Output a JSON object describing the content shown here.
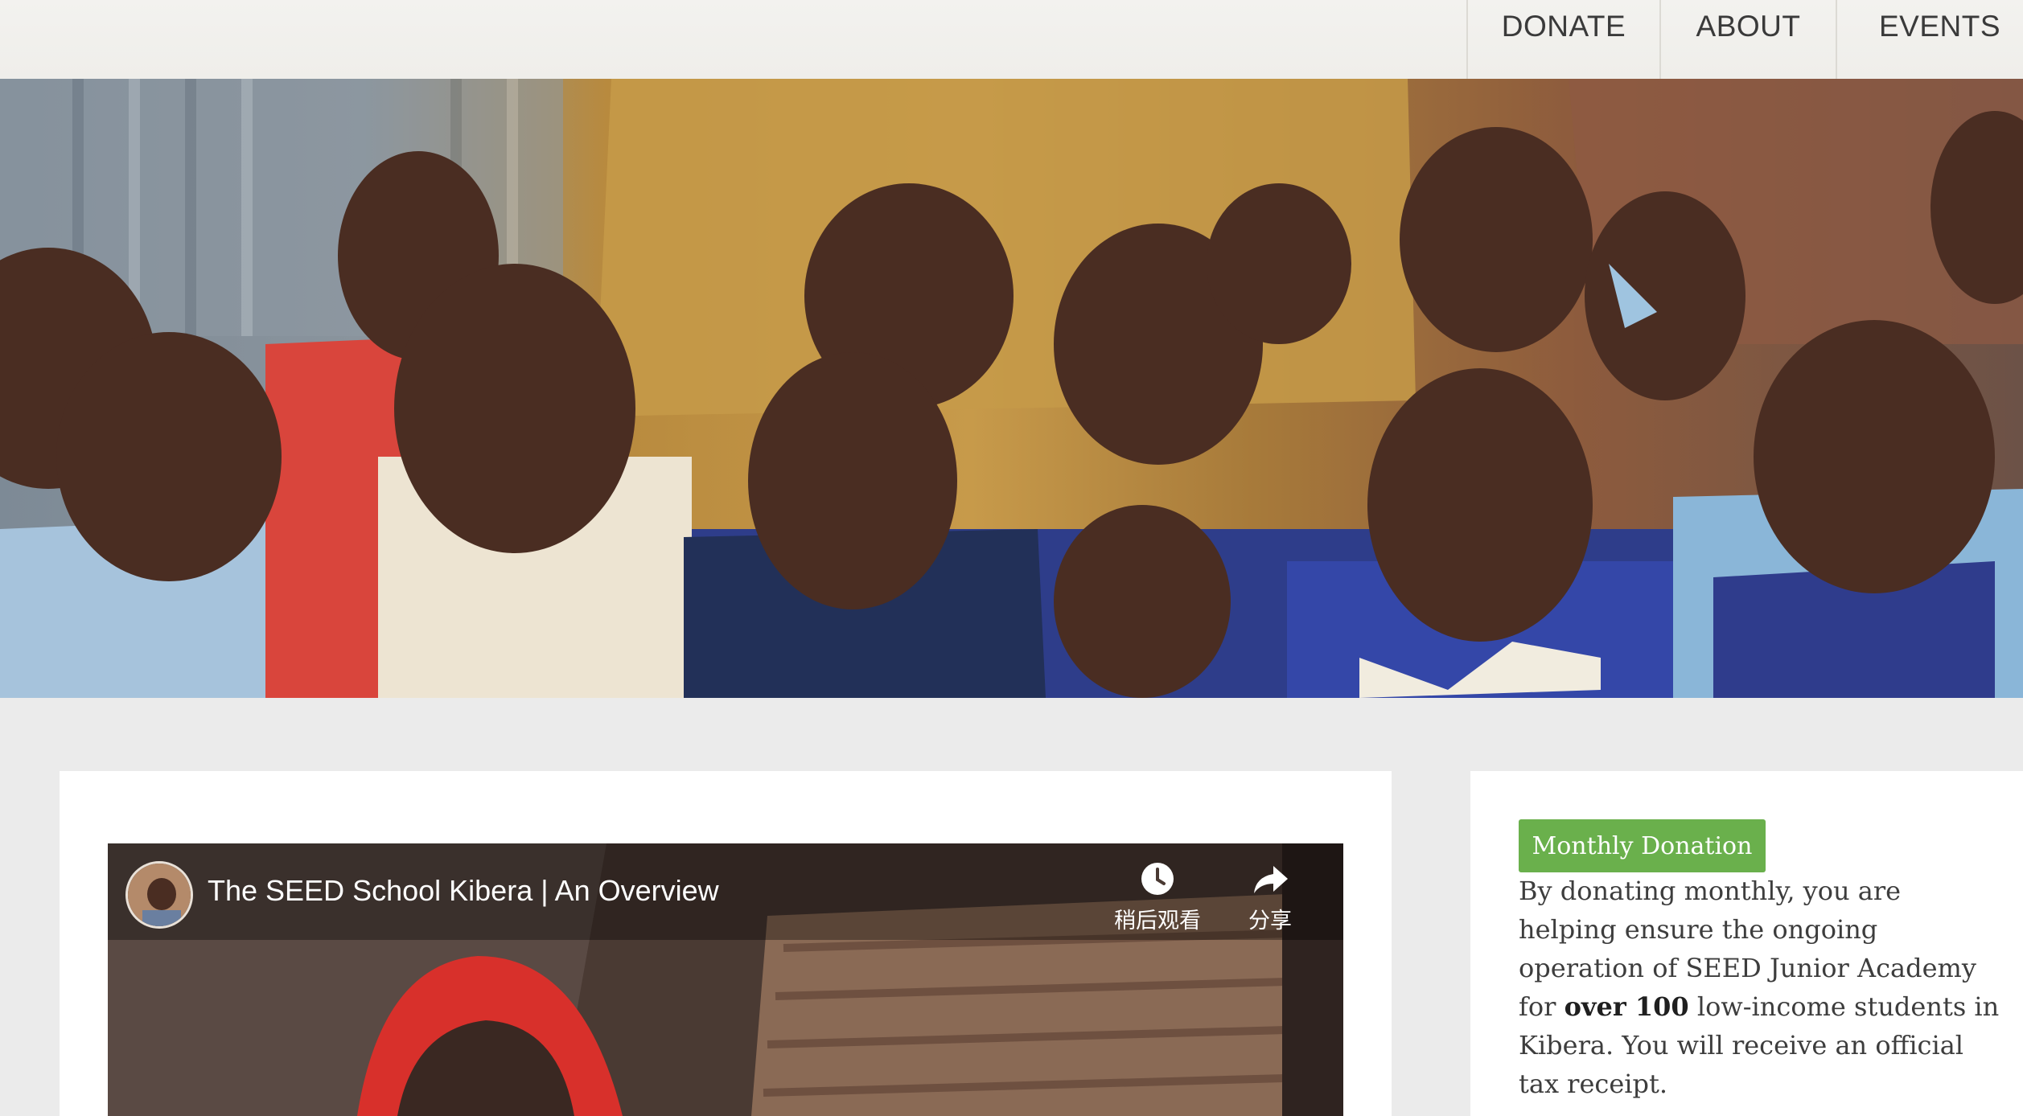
{
  "nav": {
    "donate": "DONATE",
    "about": "ABOUT",
    "events": "EVENTS"
  },
  "hero": {
    "icon": "photo-children-group"
  },
  "video": {
    "title": "The SEED School Kibera | An Overview",
    "watch_later": "稍后观看",
    "share": "分享",
    "icons": [
      "clock-icon",
      "share-icon"
    ]
  },
  "donation": {
    "button": "Monthly Donation",
    "text_before": "By donating monthly, you are helping ensure the ongoing operation of SEED Junior Academy for ",
    "text_bold": "over 100",
    "text_after": " low-income students in Kibera. You will receive an official tax receipt.",
    "accent_color": "#6ab04c"
  }
}
